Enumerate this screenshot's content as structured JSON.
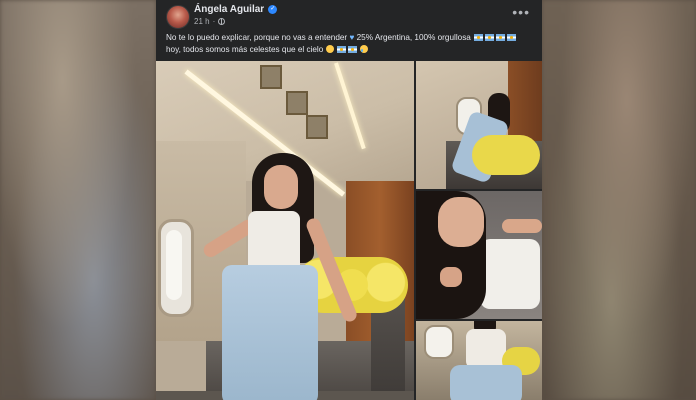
{
  "post": {
    "author": "Ángela Aguilar",
    "verified_icon": "verified-badge-icon",
    "timestamp": "21 h",
    "separator": "·",
    "privacy_icon": "globe-icon",
    "more_label": "•••",
    "caption_line1_a": "No te lo puedo explicar, porque no vas a entender",
    "caption_line1_b": "25% Argentina, 100% orgullosa",
    "caption_line2": "hoy, todos somos más celestes que el cielo",
    "emoji_icons": [
      "light-blue-heart-icon",
      "argentina-flag-icon",
      "smiling-face-icon",
      "crying-face-icon"
    ]
  },
  "photos": [
    {
      "name": "main-photo",
      "description_icon": "photo-icon"
    },
    {
      "name": "photo-2"
    },
    {
      "name": "photo-3"
    },
    {
      "name": "photo-4"
    }
  ],
  "colors": {
    "card_bg": "#242526",
    "text_primary": "#e4e6eb",
    "text_secondary": "#b0b3b8",
    "verified_blue": "#2d88ff"
  }
}
